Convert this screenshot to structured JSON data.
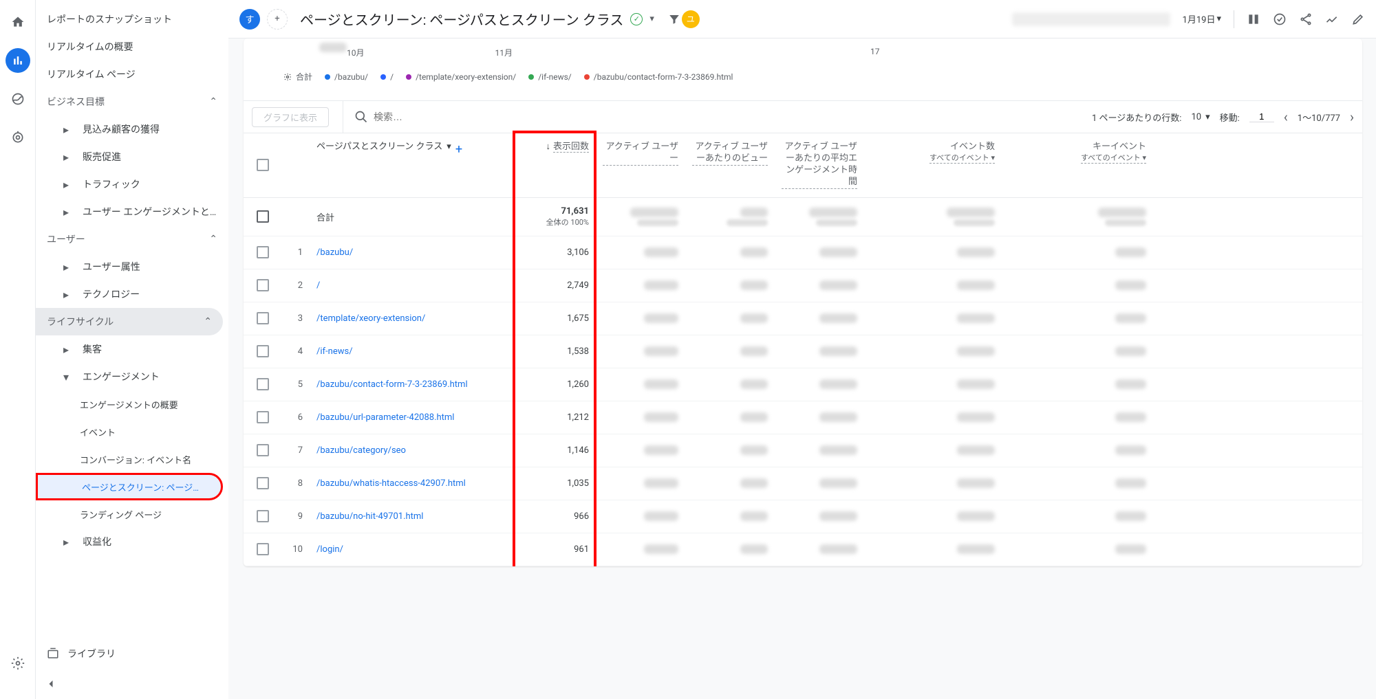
{
  "rail": {},
  "sidebar": {
    "items": {
      "snapshot": "レポートのスナップショット",
      "realtime_summary": "リアルタイムの概要",
      "realtime_pages": "リアルタイム ページ",
      "business_goals": "ビジネス目標",
      "acquire_leads": "見込み顧客の獲得",
      "sales_promotion": "販売促進",
      "traffic": "トラフィック",
      "user_engagement_trunc": "ユーザー エンゲージメントと…",
      "user_section": "ユーザー",
      "user_attributes": "ユーザー属性",
      "technology": "テクノロジー",
      "lifecycle": "ライフサイクル",
      "acquisition": "集客",
      "engagement": "エンゲージメント",
      "engagement_overview": "エンゲージメントの概要",
      "events": "イベント",
      "conversions": "コンバージョン: イベント名",
      "pages_screens": "ページとスクリーン: ページ…",
      "landing_pages": "ランディング ページ",
      "monetization": "収益化",
      "library": "ライブラリ"
    }
  },
  "header": {
    "segment_chip": "す",
    "title": "ページとスクリーン: ページパスとスクリーン クラス",
    "date_range": "1月19日",
    "avatar": "ユ"
  },
  "chart": {
    "x_oct": "10月",
    "x_nov": "11月",
    "x_17": "17"
  },
  "legend": {
    "total": "合計",
    "items": [
      {
        "color": "#1a73e8",
        "label": "/bazubu/"
      },
      {
        "color": "#2962ff",
        "label": "/"
      },
      {
        "color": "#9c27b0",
        "label": "/template/xeory-extension/"
      },
      {
        "color": "#34a853",
        "label": "/if-news/"
      },
      {
        "color": "#ea4335",
        "label": "/bazubu/contact-form-7-3-23869.html"
      }
    ]
  },
  "toolbar": {
    "plot_button": "グラフに表示",
    "search_placeholder": "検索…",
    "rows_label": "1 ページあたりの行数:",
    "rows_value": "10",
    "goto_label": "移動:",
    "goto_value": "1",
    "range": "1～10/777"
  },
  "columns": {
    "dimension": "ページパスとスクリーン クラス",
    "views": "表示回数",
    "active_users": "アクティブ ユーザー",
    "views_per_user": "アクティブ ユーザーあたりのビュー",
    "avg_engagement": "アクティブ ユーザーあたりの平均エンゲージメント時間",
    "events": "イベント数",
    "events_sub": "すべてのイベント",
    "key_events": "キーイベント",
    "key_events_sub": "すべてのイベント"
  },
  "totals": {
    "label": "合計",
    "views": "71,631",
    "views_sub": "全体の 100%"
  },
  "rows": [
    {
      "rank": "1",
      "path": "/bazubu/",
      "views": "3,106"
    },
    {
      "rank": "2",
      "path": "/",
      "views": "2,749"
    },
    {
      "rank": "3",
      "path": "/template/xeory-extension/",
      "views": "1,675"
    },
    {
      "rank": "4",
      "path": "/if-news/",
      "views": "1,538"
    },
    {
      "rank": "5",
      "path": "/bazubu/contact-form-7-3-23869.html",
      "views": "1,260"
    },
    {
      "rank": "6",
      "path": "/bazubu/url-parameter-42088.html",
      "views": "1,212"
    },
    {
      "rank": "7",
      "path": "/bazubu/category/seo",
      "views": "1,146"
    },
    {
      "rank": "8",
      "path": "/bazubu/whatis-htaccess-42907.html",
      "views": "1,035"
    },
    {
      "rank": "9",
      "path": "/bazubu/no-hit-49701.html",
      "views": "966"
    },
    {
      "rank": "10",
      "path": "/login/",
      "views": "961"
    }
  ],
  "chart_data": {
    "type": "line",
    "title": "",
    "xlabel": "",
    "ylabel": "",
    "series_names": [
      "合計",
      "/bazubu/",
      "/",
      "/template/xeory-extension/",
      "/if-news/",
      "/bazubu/contact-form-7-3-23869.html"
    ],
    "note": "Chart area mostly cropped; only x-axis month labels visible (10月, 11月, day 17). Data points not readable."
  }
}
